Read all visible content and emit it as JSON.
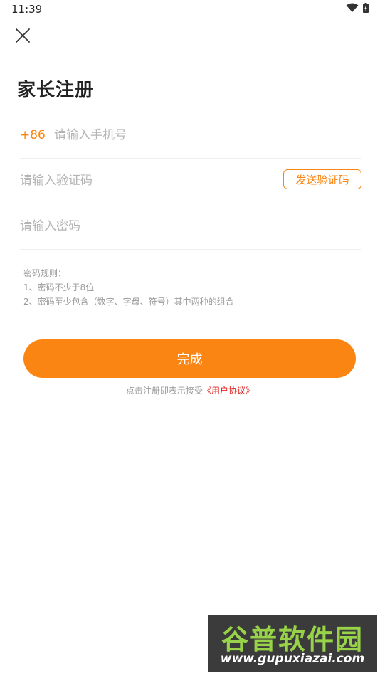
{
  "status_bar": {
    "time": "11:39",
    "icons": [
      "wifi-icon",
      "battery-icon"
    ]
  },
  "header": {
    "close_icon": "close-icon",
    "title": "家长注册"
  },
  "form": {
    "phone": {
      "country_code": "+86",
      "value": "",
      "placeholder": "请输入手机号"
    },
    "code": {
      "value": "",
      "placeholder": "请输入验证码",
      "send_button": "发送验证码"
    },
    "password": {
      "value": "",
      "placeholder": "请输入密码"
    }
  },
  "rules": {
    "title": "密码规则：",
    "items": [
      "1、密码不少于8位",
      "2、密码至少包含（数字、字母、符号）其中两种的组合"
    ]
  },
  "submit": {
    "label": "完成"
  },
  "agreement": {
    "prefix": "点击注册即表示接受",
    "link": "《用户协议》"
  },
  "watermark": {
    "title": "谷普软件园",
    "url": "www.gupuxiazai.com"
  },
  "colors": {
    "accent": "#fb8512",
    "link": "#e1211e",
    "placeholder": "#b4b4b4",
    "divider": "#eeeeee"
  }
}
